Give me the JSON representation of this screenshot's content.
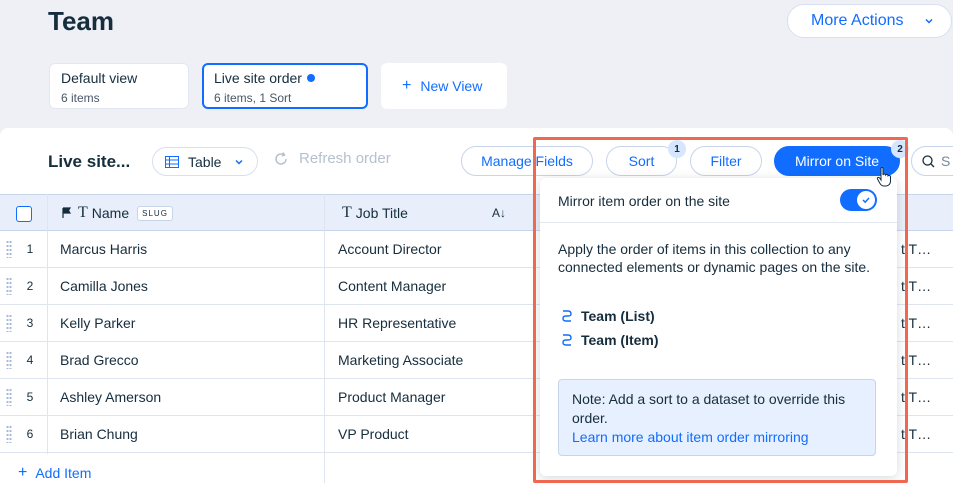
{
  "header": {
    "title": "Team",
    "more_actions_label": "More Actions"
  },
  "views": [
    {
      "name": "Default view",
      "sub": "6 items"
    },
    {
      "name": "Live site order",
      "sub": "6 items, 1 Sort"
    }
  ],
  "new_view_label": "New View",
  "toolbar": {
    "collection_title": "Live site...",
    "layout_label": "Table",
    "refresh_label": "Refresh order",
    "manage_fields_label": "Manage Fields",
    "sort_label": "Sort",
    "sort_count": "1",
    "filter_label": "Filter",
    "mirror_label": "Mirror on Site",
    "mirror_count": "2",
    "search_placeholder": "S"
  },
  "table": {
    "columns": [
      {
        "label": "Name",
        "tag": "SLUG"
      },
      {
        "label": "Job Title",
        "sort_indicator": "A↓"
      }
    ],
    "rows": [
      {
        "num": "1",
        "name": "Marcus Harris",
        "job": "Account Director",
        "extra": "t T…"
      },
      {
        "num": "2",
        "name": "Camilla Jones",
        "job": "Content Manager",
        "extra": "t T…"
      },
      {
        "num": "3",
        "name": "Kelly Parker",
        "job": "HR Representative",
        "extra": "t T…"
      },
      {
        "num": "4",
        "name": "Brad Grecco",
        "job": "Marketing Associate",
        "extra": "t T…"
      },
      {
        "num": "5",
        "name": "Ashley Amerson",
        "job": "Product Manager",
        "extra": "t T…"
      },
      {
        "num": "6",
        "name": "Brian Chung",
        "job": "VP Product",
        "extra": "t T…"
      }
    ],
    "add_item_label": "Add Item"
  },
  "popover": {
    "toggle_label": "Mirror item order on the site",
    "toggle_on": true,
    "description": "Apply the order of items in this collection to any connected elements or dynamic pages on the site.",
    "links": [
      "Team (List)",
      "Team (Item)"
    ],
    "note_text": "Note: Add a sort to a dataset to override this order.",
    "note_link": "Learn more about item order mirroring"
  },
  "colors": {
    "accent": "#116dff",
    "highlight": "#f0684f",
    "background": "#eef0f5"
  }
}
